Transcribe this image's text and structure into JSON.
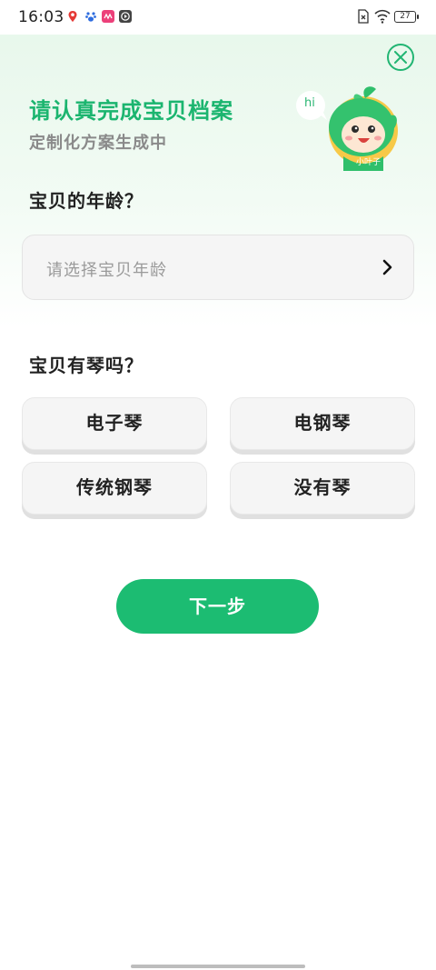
{
  "status_bar": {
    "time": "16:03",
    "battery": "27",
    "icons": [
      "location-pin-icon",
      "paw-icon",
      "app-icon",
      "play-icon",
      "sim-off-icon",
      "wifi-icon",
      "battery-icon"
    ]
  },
  "header": {
    "title": "请认真完成宝贝档案",
    "subtitle": "定制化方案生成中",
    "mascot_bubble": "hi",
    "mascot_caption": "小叶子"
  },
  "age_section": {
    "label": "宝贝的年龄？",
    "placeholder": "请选择宝贝年龄"
  },
  "piano_section": {
    "label": "宝贝有琴吗？",
    "options": [
      "电子琴",
      "电钢琴",
      "传统钢琴",
      "没有琴"
    ]
  },
  "next_button": "下一步",
  "colors": {
    "accent": "#1cbc72",
    "title_green": "#1bb56f",
    "option_bg": "#f5f5f5"
  }
}
